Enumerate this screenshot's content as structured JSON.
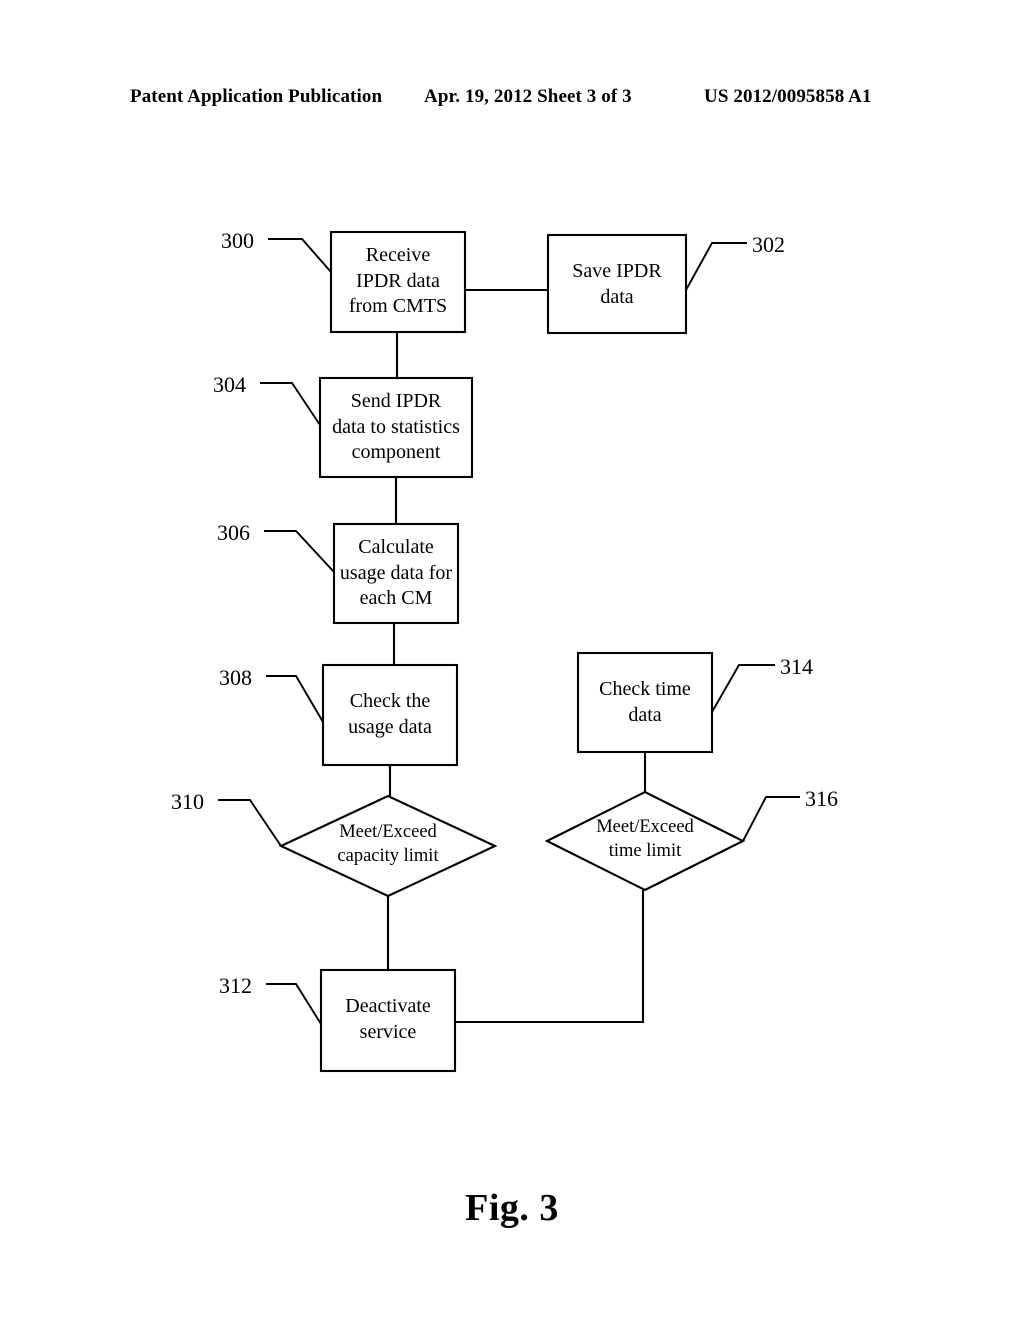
{
  "header": {
    "left": "Patent Application Publication",
    "middle": "Apr. 19, 2012  Sheet 3 of 3",
    "right": "US 2012/0095858 A1"
  },
  "figure": {
    "caption": "Fig. 3",
    "nodes": [
      {
        "ref": "300",
        "shape": "process",
        "text": "Receive\nIPDR data\nfrom CMTS"
      },
      {
        "ref": "302",
        "shape": "process",
        "text": "Save IPDR\ndata"
      },
      {
        "ref": "304",
        "shape": "process",
        "text": "Send IPDR\ndata to statistics\ncomponent"
      },
      {
        "ref": "306",
        "shape": "process",
        "text": "Calculate\nusage data for\neach CM"
      },
      {
        "ref": "308",
        "shape": "process",
        "text": "Check the\nusage data"
      },
      {
        "ref": "310",
        "shape": "decision",
        "text": "Meet/Exceed\ncapacity limit"
      },
      {
        "ref": "312",
        "shape": "process",
        "text": "Deactivate\nservice"
      },
      {
        "ref": "314",
        "shape": "process",
        "text": "Check time\ndata"
      },
      {
        "ref": "316",
        "shape": "decision",
        "text": "Meet/Exceed\ntime limit"
      }
    ],
    "node_labels": {
      "n300_l1": "Receive",
      "n300_l2": "IPDR data",
      "n300_l3": "from CMTS",
      "n302_l1": "Save IPDR",
      "n302_l2": "data",
      "n304_l1": "Send IPDR",
      "n304_l2": "data to statistics",
      "n304_l3": "component",
      "n306_l1": "Calculate",
      "n306_l2": "usage data for",
      "n306_l3": "each CM",
      "n308_l1": "Check the",
      "n308_l2": "usage data",
      "n310_l1": "Meet/Exceed",
      "n310_l2": "capacity limit",
      "n312_l1": "Deactivate",
      "n312_l2": "service",
      "n314_l1": "Check time",
      "n314_l2": "data",
      "n316_l1": "Meet/Exceed",
      "n316_l2": "time limit"
    },
    "refs": {
      "r300": "300",
      "r302": "302",
      "r304": "304",
      "r306": "306",
      "r308": "308",
      "r310": "310",
      "r312": "312",
      "r314": "314",
      "r316": "316"
    }
  },
  "colors": {
    "ink": "#000000",
    "paper": "#ffffff"
  }
}
